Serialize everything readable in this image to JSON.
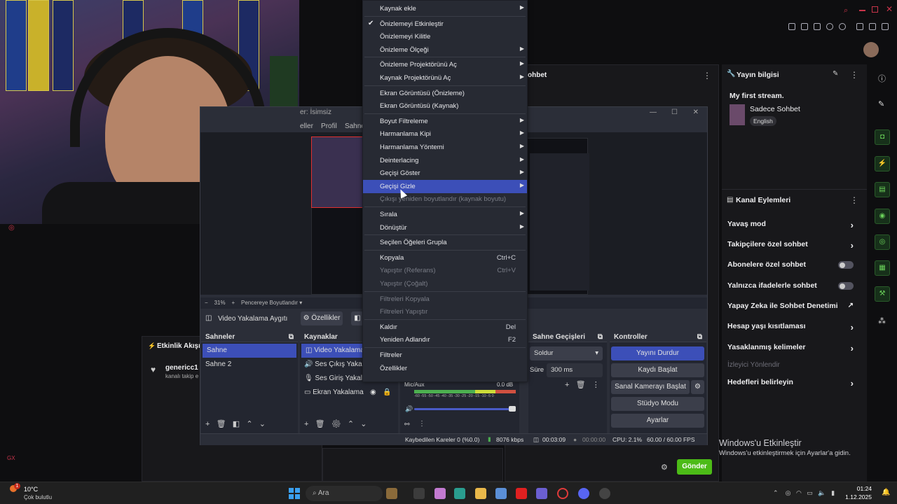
{
  "webcam": {
    "hint_label": "webcam"
  },
  "twitch": {
    "chat_title_partial": "ohbet",
    "stream_info_title": "Yayın bilgisi",
    "stream_name": "My first stream.",
    "category": "Sadece Sohbet",
    "language_tag": "English",
    "channel_actions_title": "Kanal Eylemleri",
    "channel_actions": [
      {
        "label": "Yavaş mod",
        "kind": "arrow"
      },
      {
        "label": "Takipçilere özel sohbet",
        "kind": "arrow"
      },
      {
        "label": "Abonelere özel sohbet",
        "kind": "toggle"
      },
      {
        "label": "Yalnızca ifadelerle sohbet",
        "kind": "toggle"
      },
      {
        "label": "Yapay Zeka ile Sohbet Denetimi",
        "kind": "external"
      },
      {
        "label": "Hesap yaşı kısıtlaması",
        "kind": "arrow"
      },
      {
        "label": "Yasaklanmış kelimeler",
        "kind": "arrow"
      },
      {
        "label": "İzleyici Yönlendir",
        "kind": "disabled"
      },
      {
        "label": "Hedefleri belirleyin",
        "kind": "arrow"
      }
    ],
    "activity_title": "Etkinlik Akışı",
    "activity_user": "genericc1",
    "activity_text": "kanalı takip e",
    "send_button": "Gönder"
  },
  "obs": {
    "window_title": "er: İsimsiz",
    "menubar": [
      "eller",
      "Profil",
      "Sahne"
    ],
    "zoom": "31%",
    "fit_label": "Pencereye Boyutlandır",
    "source_name": "Video Yakalama Aygıtı",
    "properties_btn": "Özellikler",
    "scenes_title": "Sahneler",
    "scenes": [
      "Sahne",
      "Sahne 2"
    ],
    "sources_title": "Kaynaklar",
    "sources": [
      "Video Yakalama A",
      "Ses Çıkış Yakalayıc",
      "Ses Giriş Yakalayıc",
      "Ekran Yakalama"
    ],
    "mic_label": "Mic/Aux",
    "mic_db": "0.0 dB",
    "meter_ticks": "-60 -55 -50 -45 -40 -35 -30 -25 -20 -15 -10 -5 0",
    "transitions_title": "Sahne Geçişleri",
    "transition_value": "Soldur",
    "duration_label": "Süre",
    "duration_value": "300 ms",
    "controls_title": "Kontroller",
    "controls": [
      "Yayını Durdur",
      "Kaydı Başlat",
      "Sanal Kamerayı Başlat",
      "Stüdyo Modu",
      "Ayarlar"
    ],
    "status": {
      "dropped": "Kaybedilen Kareler 0 (%0.0)",
      "bitrate": "8076 kbps",
      "live_time": "00:03:09",
      "rec_time": "00:00:00",
      "cpu": "CPU: 2.1%",
      "fps": "60.00 / 60.00 FPS"
    }
  },
  "context_menu": {
    "items": [
      {
        "label": "Kaynak ekle",
        "sub": true
      },
      {
        "sep": true
      },
      {
        "label": "Önizlemeyi Etkinleştir",
        "check": true
      },
      {
        "label": "Önizlemeyi Kilitle"
      },
      {
        "label": "Önizleme Ölçeği",
        "sub": true
      },
      {
        "sep": true
      },
      {
        "label": "Önizleme Projektörünü Aç",
        "sub": true
      },
      {
        "label": "Kaynak Projektörünü Aç",
        "sub": true
      },
      {
        "sep": true
      },
      {
        "label": "Ekran Görüntüsü (Önizleme)"
      },
      {
        "label": "Ekran Görüntüsü (Kaynak)"
      },
      {
        "sep": true
      },
      {
        "label": "Boyut Filtreleme",
        "sub": true
      },
      {
        "label": "Harmanlama Kipi",
        "sub": true
      },
      {
        "label": "Harmanlama Yöntemi",
        "sub": true
      },
      {
        "label": "Deinterlacing",
        "sub": true
      },
      {
        "label": "Geçişi Göster",
        "sub": true
      },
      {
        "label": "Geçişi Gizle",
        "sub": true,
        "highlight": true
      },
      {
        "label": "Çıkışı yeniden boyutlandır (kaynak boyutu)",
        "disabled": true
      },
      {
        "sep": true
      },
      {
        "label": "Sırala",
        "sub": true
      },
      {
        "label": "Dönüştür",
        "sub": true
      },
      {
        "sep": true
      },
      {
        "label": "Seçilen Öğeleri Grupla"
      },
      {
        "sep": true
      },
      {
        "label": "Kopyala",
        "shortcut": "Ctrl+C"
      },
      {
        "label": "Yapıştır (Referans)",
        "shortcut": "Ctrl+V",
        "disabled": true
      },
      {
        "label": "Yapıştır (Çoğalt)",
        "disabled": true
      },
      {
        "sep": true
      },
      {
        "label": "Filtreleri Kopyala",
        "disabled": true
      },
      {
        "label": "Filtreleri Yapıştır",
        "disabled": true
      },
      {
        "sep": true
      },
      {
        "label": "Kaldır",
        "shortcut": "Del"
      },
      {
        "label": "Yeniden Adlandır",
        "shortcut": "F2"
      },
      {
        "sep": true
      },
      {
        "label": "Filtreler"
      },
      {
        "label": "Özellikler"
      }
    ]
  },
  "windows": {
    "activate_title": "Windows'u Etkinleştir",
    "activate_sub": "Windows'u etkinleştirmek için Ayarlar'a gidin.",
    "weather_temp": "10°C",
    "weather_desc": "Çok bulutlu",
    "weather_badge": "1",
    "search_placeholder": "Ara",
    "time": "01:24",
    "date": "1.12.2025"
  }
}
